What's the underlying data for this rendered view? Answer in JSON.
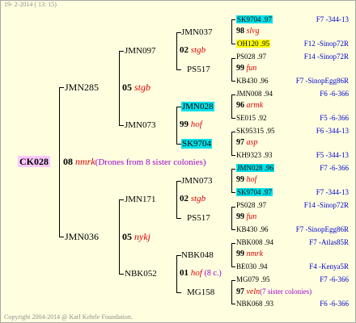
{
  "header": {
    "date": "19-  2-2014 ( 13: 15)"
  },
  "footer": {
    "copyright": "Copyright 2004-2014 @ Karl Kehrle Foundation."
  },
  "root": {
    "id": "CK028",
    "year": "08",
    "breeder": "nmrk",
    "note": "(Drones from 8 sister colonies)"
  },
  "gen1": [
    {
      "id": "JMN285",
      "year": "05",
      "breeder": "stgb"
    },
    {
      "id": "JMN036",
      "year": "05",
      "breeder": "nykj"
    }
  ],
  "gen2": [
    {
      "id": "JMN097",
      "year": "02",
      "breeder": "stgb"
    },
    {
      "id": "JMN073",
      "year": "99",
      "breeder": "hof"
    },
    {
      "id": "JMN171",
      "year": "02",
      "breeder": "stgb"
    },
    {
      "id": "NBK052",
      "year": "01",
      "breeder": "hof",
      "note": "(8 c.)"
    }
  ],
  "gen3": [
    {
      "id": "JMN037"
    },
    {
      "id": "PS517"
    },
    {
      "id": "JMN028"
    },
    {
      "id": "SK9704"
    },
    {
      "id": "JMN073"
    },
    {
      "id": "PS517"
    },
    {
      "id": "NBK048"
    },
    {
      "id": "MG158"
    }
  ],
  "gen4": [
    {
      "top": "SK9704 .97",
      "mid_year": "98",
      "mid_breeder": "slvg",
      "bottom": "OH120 .95",
      "top_line": "F7 -344-13",
      "bottom_line": "F12 -Sinop72R"
    },
    {
      "top": "PS028 .97",
      "mid_year": "99",
      "mid_breeder": "fun",
      "bottom": "KB430 .96",
      "top_line": "F14 -Sinop72R",
      "bottom_line": "F7 -SinopEgg86R"
    },
    {
      "top": "JMN008 .94",
      "mid_year": "96",
      "mid_breeder": "armk",
      "bottom": "SE015 .92",
      "top_line": "F6 -6-366",
      "bottom_line": "F5 -6-366"
    },
    {
      "top": "SK95315 .95",
      "mid_year": "97",
      "mid_breeder": "asp",
      "bottom": "KH9323 .93",
      "top_line": "F6 -344-13",
      "bottom_line": "F5 -344-13"
    },
    {
      "top": "JMN028 .96",
      "mid_year": "99",
      "mid_breeder": "hof",
      "bottom": "SK9704 .97",
      "top_line": "F7 -6-366",
      "bottom_line": "F7 -344-13"
    },
    {
      "top": "PS028 .97",
      "mid_year": "99",
      "mid_breeder": "fun",
      "bottom": "KB430 .96",
      "top_line": "F14 -Sinop72R",
      "bottom_line": "F7 -SinopEgg86R"
    },
    {
      "top": "NBK008 .94",
      "mid_year": "99",
      "mid_breeder": "nmrk",
      "bottom": "BE030 .94",
      "top_line": "F7 -Atlas85R",
      "bottom_line": "F4 -Kenya5R"
    },
    {
      "top": "MG079 .95",
      "mid_year": "97",
      "mid_breeder": "veln",
      "mid_note": "(7 sister colonies)",
      "bottom": "NBK068 .93",
      "top_line": "F7 -6-366",
      "bottom_line": "F6 -6-366"
    }
  ]
}
